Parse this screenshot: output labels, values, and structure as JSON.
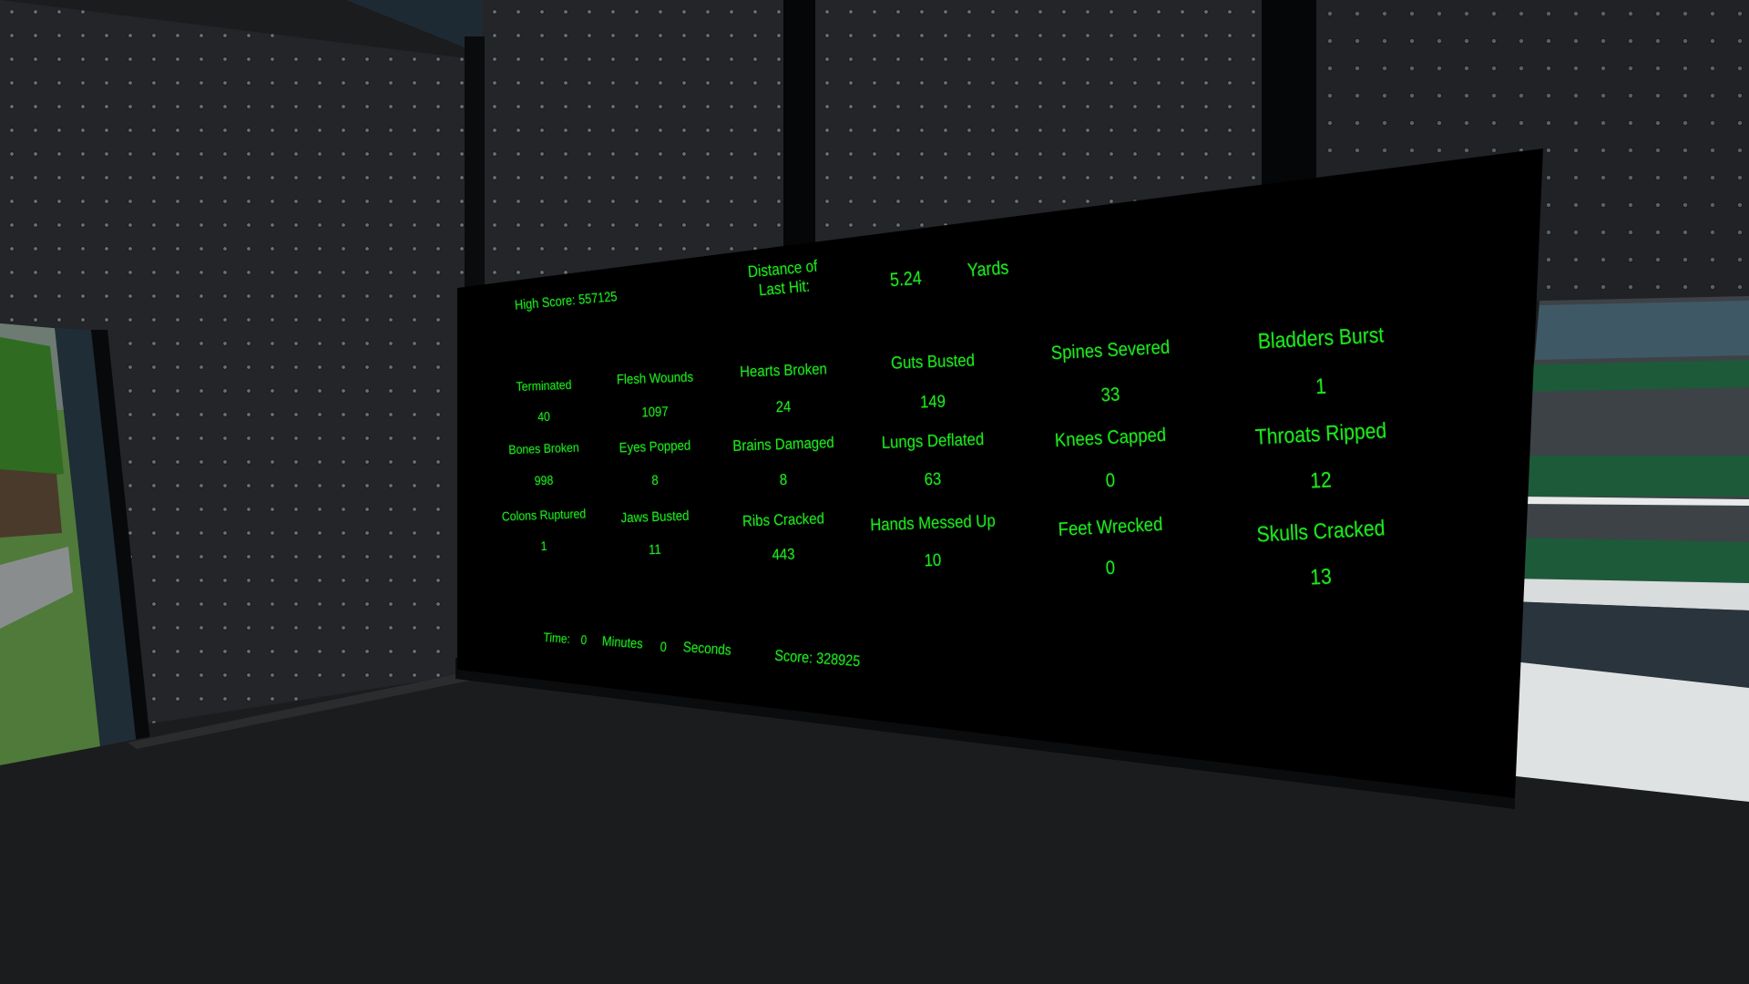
{
  "scene": {
    "description": "3D room with a black stats scoreboard on the wall",
    "text_color": "#1ee81e"
  },
  "header": {
    "high_score_label": "High Score:",
    "high_score_value": "557125",
    "distance_label_line1": "Distance of",
    "distance_label_line2": "Last Hit:",
    "distance_value": "5.24",
    "distance_unit": "Yards"
  },
  "stats": [
    {
      "label": "Terminated",
      "value": "40"
    },
    {
      "label": "Flesh Wounds",
      "value": "1097"
    },
    {
      "label": "Hearts Broken",
      "value": "24"
    },
    {
      "label": "Guts Busted",
      "value": "149"
    },
    {
      "label": "Spines Severed",
      "value": "33"
    },
    {
      "label": "Bladders Burst",
      "value": "1"
    },
    {
      "label": "Bones Broken",
      "value": "998"
    },
    {
      "label": "Eyes Popped",
      "value": "8"
    },
    {
      "label": "Brains Damaged",
      "value": "8"
    },
    {
      "label": "Lungs Deflated",
      "value": "63"
    },
    {
      "label": "Knees Capped",
      "value": "0"
    },
    {
      "label": "Throats Ripped",
      "value": "12"
    },
    {
      "label": "Colons Ruptured",
      "value": "1"
    },
    {
      "label": "Jaws Busted",
      "value": "11"
    },
    {
      "label": "Ribs Cracked",
      "value": "443"
    },
    {
      "label": "Hands Messed Up",
      "value": "10"
    },
    {
      "label": "Feet Wrecked",
      "value": "0"
    },
    {
      "label": "Skulls Cracked",
      "value": "13"
    }
  ],
  "footer": {
    "time_label": "Time:",
    "minutes_value": "0",
    "minutes_label": "Minutes",
    "seconds_value": "0",
    "seconds_label": "Seconds",
    "score_label": "Score:",
    "score_value": "328925"
  }
}
